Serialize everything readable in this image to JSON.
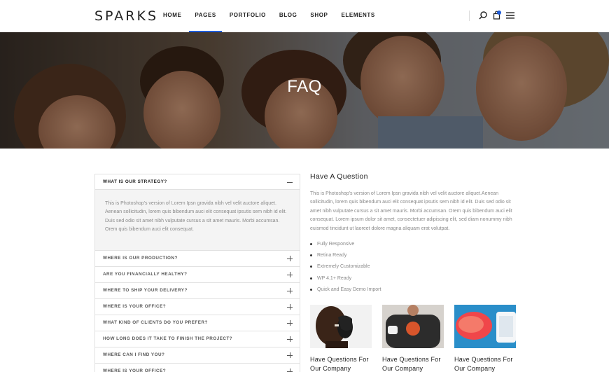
{
  "header": {
    "logo": "SPARKS",
    "nav": [
      "HOME",
      "PAGES",
      "PORTFOLIO",
      "BLOG",
      "SHOP",
      "ELEMENTS"
    ],
    "active_nav": "PAGES",
    "icons": [
      "search-icon",
      "cart-icon",
      "menu-icon"
    ],
    "accent_color": "#1e5bd8"
  },
  "hero": {
    "title": "FAQ"
  },
  "accordion": {
    "open": {
      "question": "WHAT IS OUR STRATEGY?",
      "answer": "This is Photoshop's version  of Lorem Ipsn gravida nibh vel velit auctore aliquet. Aenean sollicitudin, lorem quis bibendum auci elit consequat ipsutis sem nibh id elit. Duis sed odio sit amet nibh vulputate cursus a sit amet mauris. Morbi accumsan. Orem quis bibendum auci elit consequat."
    },
    "items": [
      "WHERE IS OUR PRODUCTION?",
      "ARE YOU FINANCIALLY HEALTHY?",
      "WHERE TO SHIP YOUR DELIVERY?",
      "WHERE IS YOUR OFFICE?",
      "WHAT KIND OF CLIENTS DO YOU PREFER?",
      "HOW LONG DOES IT TAKE TO FINISH THE PROJECT?",
      "WHERE CAN I FIND YOU?",
      "WHERE IS YOUR OFFICE?"
    ]
  },
  "side": {
    "title": "Have A Question",
    "text": "This is Photoshop's version  of Lorem Ipsn gravida nibh vel velit auctore  aliquet.Aenean sollicitudin, lorem quis bibendum auci elit consequat ipsutis sem nibh id elit. Duis sed odio sit amet nibh vulputate cursus a sit amet mauris. Morbi accumsan. Orem quis bibendum auci elit consequat. Lorem ipsum dolor sit amet, consectetuer adipiscing elit, sed diam nonummy nibh euismod tincidunt ut laoreet dolore magna aliquam erat volutpat.",
    "features": [
      "Fully Responsive",
      "Retina Ready",
      "Extremely Customizable",
      "WP 4.1+ Ready",
      "Quick and Easy Demo Import"
    ]
  },
  "cards": [
    {
      "title": "Have Questions For Our Company"
    },
    {
      "title": "Have Questions For Our Company"
    },
    {
      "title": "Have Questions For Our Company"
    }
  ]
}
